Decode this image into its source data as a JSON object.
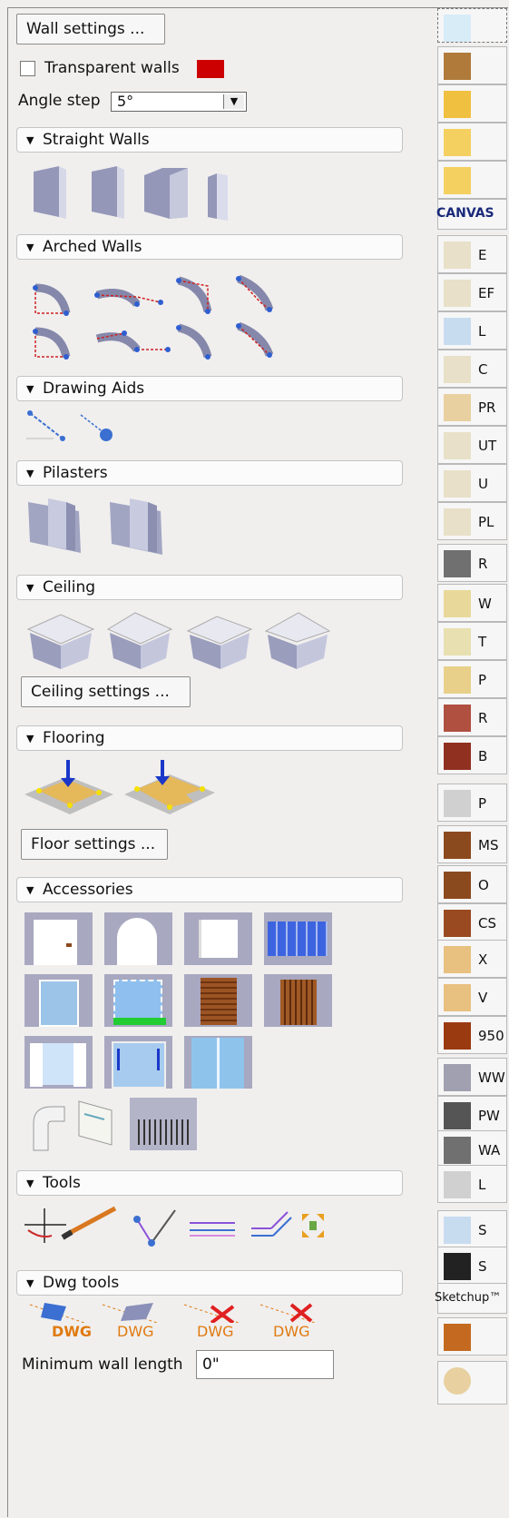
{
  "wall_settings_label": "Wall settings ...",
  "transparent_walls_label": "Transparent walls",
  "wall_color": "#cc0000",
  "angle_step_label": "Angle step",
  "angle_step_value": "5°",
  "sections": {
    "straight_walls": "Straight Walls",
    "arched_walls": "Arched Walls",
    "drawing_aids": "Drawing Aids",
    "pilasters": "Pilasters",
    "ceiling": "Ceiling",
    "flooring": "Flooring",
    "accessories": "Accessories",
    "tools": "Tools",
    "dwg_tools": "Dwg tools"
  },
  "ceiling_settings_label": "Ceiling settings ...",
  "floor_settings_label": "Floor settings ...",
  "dwg_label": "DWG",
  "min_wall_length_label": "Minimum wall length",
  "min_wall_length_value": "0\"",
  "canvas_label": "CANVAS",
  "sketchup_label": "Sketchup™",
  "right_labels": [
    "E",
    "EF",
    "L",
    "C",
    "PR",
    "UT",
    "U",
    "PL",
    "R",
    "W",
    "T",
    "P",
    "R",
    "B",
    "P",
    "MS",
    "O",
    "CS",
    "X",
    "V",
    "950",
    "WW",
    "PW",
    "WA",
    "L",
    "S",
    "S"
  ],
  "colors": {
    "accent_blue": "#3b6fd1",
    "wall_grey": "#8e91b0",
    "wood": "#8b4a1e",
    "dwg_orange": "#e07a10"
  }
}
